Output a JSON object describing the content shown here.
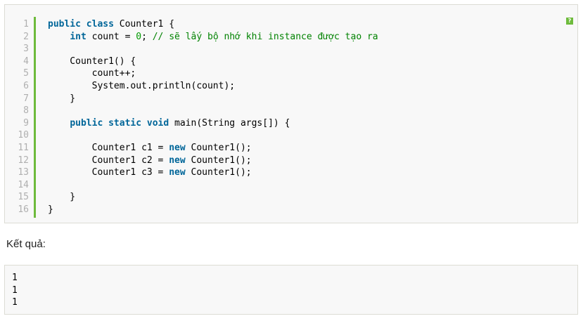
{
  "code_block": {
    "help_label": "?",
    "line_numbers": [
      "1",
      "2",
      "3",
      "4",
      "5",
      "6",
      "7",
      "8",
      "9",
      "10",
      "11",
      "12",
      "13",
      "14",
      "15",
      "16"
    ],
    "lines": {
      "l1": {
        "kw": "public class",
        "text": " Counter1 {"
      },
      "l2": {
        "indent": "    ",
        "kw": "int",
        "text": " count = ",
        "num": "0",
        "text2": "; ",
        "comment": "// sẽ lấy bộ nhớ khi instance được tạo ra"
      },
      "l4": {
        "text": "    Counter1() {"
      },
      "l5": {
        "text": "        count++;"
      },
      "l6": {
        "text": "        System.out.println(count);"
      },
      "l7": {
        "text": "    }"
      },
      "l9": {
        "indent": "    ",
        "kw": "public static void",
        "text": " main(String args[]) {"
      },
      "l11": {
        "indent": "        ",
        "text": "Counter1 c1 = ",
        "kw": "new",
        "text2": " Counter1();"
      },
      "l12": {
        "indent": "        ",
        "text": "Counter1 c2 = ",
        "kw": "new",
        "text2": " Counter1();"
      },
      "l13": {
        "indent": "        ",
        "text": "Counter1 c3 = ",
        "kw": "new",
        "text2": " Counter1();"
      },
      "l15": {
        "text": "    }"
      },
      "l16": {
        "text": "}"
      }
    }
  },
  "result": {
    "label": "Kết quả:",
    "lines": [
      "1",
      "1",
      "1"
    ]
  }
}
